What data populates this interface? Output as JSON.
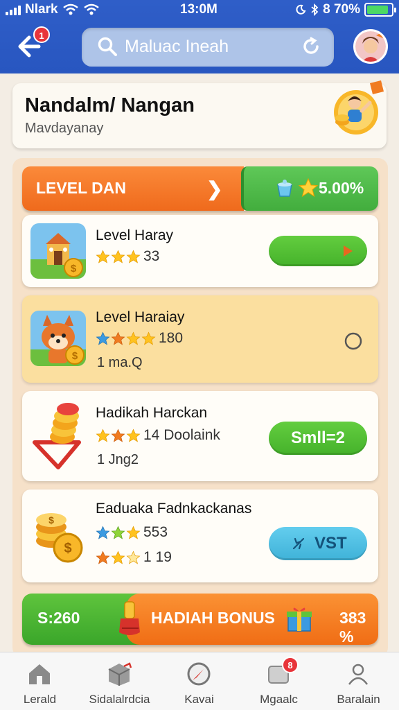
{
  "status": {
    "carrier": "Nlark",
    "time": "13:0M",
    "battery": "8 70%"
  },
  "header": {
    "back_badge": "1",
    "search_text": "Maluac Ineah"
  },
  "profile": {
    "name": "Nandalm/ Nangan",
    "subtitle": "Mavdayanay"
  },
  "level_bar": {
    "label": "LEVEL DAN",
    "value": "5.00%"
  },
  "items": [
    {
      "title": "Level Haray",
      "rating": "33",
      "stars": 3
    },
    {
      "title": "Level Haraiay",
      "rating": "180",
      "sub": "1 ma.Q",
      "stars": 3
    },
    {
      "title": "Hadikah Harckan",
      "rating": "14 Doolaink",
      "sub": "1 Jng2",
      "button": "Smll=2",
      "stars": 3
    },
    {
      "title": "Eaduaka Fadnkackanas",
      "rating": "553",
      "rating2": "1 19",
      "button": "VST",
      "stars": 3
    }
  ],
  "bonus": {
    "left": "S:260",
    "label": "HADIAH BONUS",
    "right": "383 %"
  },
  "nav": [
    {
      "label": "Lerald"
    },
    {
      "label": "Sidalalrdcia"
    },
    {
      "label": "Kavai"
    },
    {
      "label": "Mgaalc",
      "badge": "8"
    },
    {
      "label": "Baralain"
    }
  ],
  "colors": {
    "header": "#2f5ec8",
    "accent_orange": "#f47a26",
    "accent_green": "#4cb843",
    "highlight": "#fbdf9f"
  }
}
